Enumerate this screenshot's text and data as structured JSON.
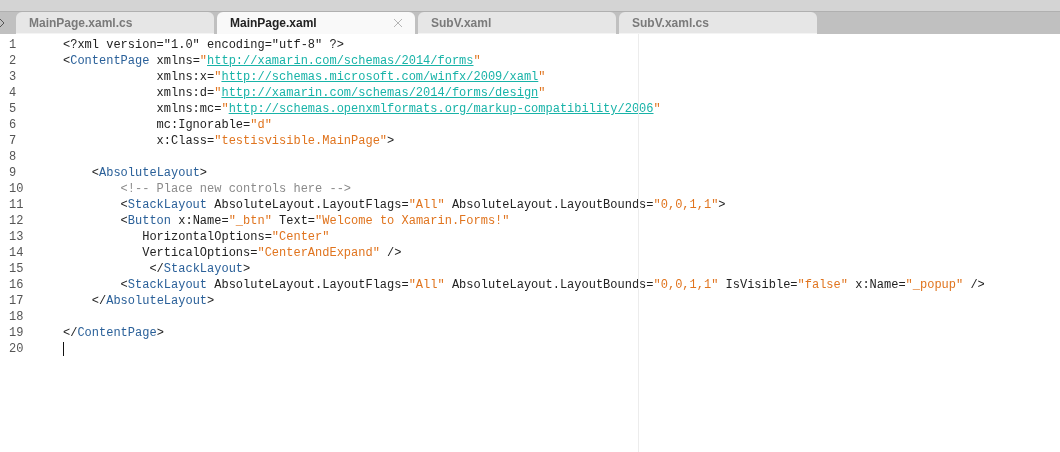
{
  "tabs": [
    {
      "label": "MainPage.xaml.cs",
      "selected": false
    },
    {
      "label": "MainPage.xaml",
      "selected": true
    },
    {
      "label": "SubV.xaml",
      "selected": false
    },
    {
      "label": "SubV.xaml.cs",
      "selected": false
    }
  ],
  "editor": {
    "lines": [
      {
        "number": "1",
        "cursor": false,
        "tokens": [
          {
            "kind": "plain",
            "text": "<?xml version=\"1.0\" encoding=\"utf-8\" ?>"
          }
        ]
      },
      {
        "number": "2",
        "cursor": false,
        "tokens": [
          {
            "kind": "plain",
            "text": "<"
          },
          {
            "kind": "tag",
            "text": "ContentPage"
          },
          {
            "kind": "plain",
            "text": " xmlns="
          },
          {
            "kind": "string",
            "text": "\""
          },
          {
            "kind": "link",
            "text": "http://xamarin.com/schemas/2014/forms"
          },
          {
            "kind": "string",
            "text": "\""
          }
        ]
      },
      {
        "number": "3",
        "cursor": false,
        "tokens": [
          {
            "kind": "plain",
            "text": "             xmlns:x="
          },
          {
            "kind": "string",
            "text": "\""
          },
          {
            "kind": "link",
            "text": "http://schemas.microsoft.com/winfx/2009/xaml"
          },
          {
            "kind": "string",
            "text": "\""
          }
        ]
      },
      {
        "number": "4",
        "cursor": false,
        "tokens": [
          {
            "kind": "plain",
            "text": "             xmlns:d="
          },
          {
            "kind": "string",
            "text": "\""
          },
          {
            "kind": "link",
            "text": "http://xamarin.com/schemas/2014/forms/design"
          },
          {
            "kind": "string",
            "text": "\""
          }
        ]
      },
      {
        "number": "5",
        "cursor": false,
        "tokens": [
          {
            "kind": "plain",
            "text": "             xmlns:mc="
          },
          {
            "kind": "string",
            "text": "\""
          },
          {
            "kind": "link",
            "text": "http://schemas.openxmlformats.org/markup-compatibility/2006"
          },
          {
            "kind": "string",
            "text": "\""
          }
        ]
      },
      {
        "number": "6",
        "cursor": false,
        "tokens": [
          {
            "kind": "plain",
            "text": "             mc:Ignorable="
          },
          {
            "kind": "string",
            "text": "\"d\""
          }
        ]
      },
      {
        "number": "7",
        "cursor": false,
        "tokens": [
          {
            "kind": "plain",
            "text": "             x:Class="
          },
          {
            "kind": "string",
            "text": "\"testisvisible.MainPage\""
          },
          {
            "kind": "plain",
            "text": ">"
          }
        ]
      },
      {
        "number": "8",
        "cursor": false
      },
      {
        "number": "9",
        "cursor": false,
        "tokens": [
          {
            "kind": "plain",
            "text": "    <"
          },
          {
            "kind": "tag",
            "text": "AbsoluteLayout"
          },
          {
            "kind": "plain",
            "text": ">"
          }
        ]
      },
      {
        "number": "10",
        "cursor": false,
        "tokens": [
          {
            "kind": "comment",
            "text": "        <!-- Place new controls here -->"
          }
        ]
      },
      {
        "number": "11",
        "cursor": false,
        "tokens": [
          {
            "kind": "plain",
            "text": "        <"
          },
          {
            "kind": "tag",
            "text": "StackLayout"
          },
          {
            "kind": "plain",
            "text": " AbsoluteLayout.LayoutFlags="
          },
          {
            "kind": "string",
            "text": "\"All\""
          },
          {
            "kind": "plain",
            "text": " AbsoluteLayout.LayoutBounds="
          },
          {
            "kind": "string",
            "text": "\"0,0,1,1\""
          },
          {
            "kind": "plain",
            "text": ">"
          }
        ]
      },
      {
        "number": "12",
        "cursor": false,
        "tokens": [
          {
            "kind": "plain",
            "text": "        <"
          },
          {
            "kind": "tag",
            "text": "Button"
          },
          {
            "kind": "plain",
            "text": " x:Name="
          },
          {
            "kind": "string",
            "text": "\"_btn\""
          },
          {
            "kind": "plain",
            "text": " Text="
          },
          {
            "kind": "string",
            "text": "\"Welcome to Xamarin.Forms!\""
          }
        ]
      },
      {
        "number": "13",
        "cursor": false,
        "tokens": [
          {
            "kind": "plain",
            "text": "           HorizontalOptions="
          },
          {
            "kind": "string",
            "text": "\"Center\""
          }
        ]
      },
      {
        "number": "14",
        "cursor": false,
        "tokens": [
          {
            "kind": "plain",
            "text": "           VerticalOptions="
          },
          {
            "kind": "string",
            "text": "\"CenterAndExpand\""
          },
          {
            "kind": "plain",
            "text": " />"
          }
        ]
      },
      {
        "number": "15",
        "cursor": false,
        "tokens": [
          {
            "kind": "plain",
            "text": "            </"
          },
          {
            "kind": "tag",
            "text": "StackLayout"
          },
          {
            "kind": "plain",
            "text": ">"
          }
        ]
      },
      {
        "number": "16",
        "cursor": false,
        "tokens": [
          {
            "kind": "plain",
            "text": "        <"
          },
          {
            "kind": "tag",
            "text": "StackLayout"
          },
          {
            "kind": "plain",
            "text": " AbsoluteLayout.LayoutFlags="
          },
          {
            "kind": "string",
            "text": "\"All\""
          },
          {
            "kind": "plain",
            "text": " AbsoluteLayout.LayoutBounds="
          },
          {
            "kind": "string",
            "text": "\"0,0,1,1\""
          },
          {
            "kind": "plain",
            "text": " IsVisible="
          },
          {
            "kind": "string",
            "text": "\"false\""
          },
          {
            "kind": "plain",
            "text": " x:Name="
          },
          {
            "kind": "string",
            "text": "\"_popup\""
          },
          {
            "kind": "plain",
            "text": " />"
          }
        ]
      },
      {
        "number": "17",
        "cursor": false,
        "tokens": [
          {
            "kind": "plain",
            "text": "    </"
          },
          {
            "kind": "tag",
            "text": "AbsoluteLayout"
          },
          {
            "kind": "plain",
            "text": ">"
          }
        ]
      },
      {
        "number": "18",
        "cursor": false
      },
      {
        "number": "19",
        "cursor": false,
        "tokens": [
          {
            "kind": "plain",
            "text": "</"
          },
          {
            "kind": "tag",
            "text": "ContentPage"
          },
          {
            "kind": "plain",
            "text": ">"
          }
        ]
      },
      {
        "number": "20",
        "cursor": true
      }
    ]
  }
}
